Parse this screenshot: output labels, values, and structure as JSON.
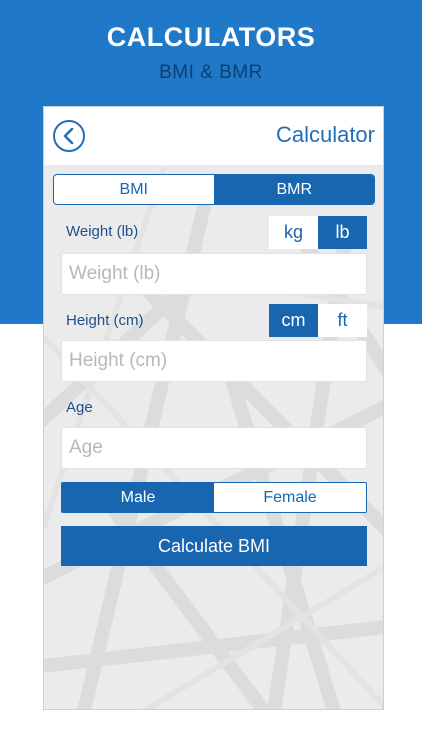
{
  "hero": {
    "title": "CALCULATORS",
    "subtitle": "BMI & BMR"
  },
  "appbar": {
    "title": "Calculator",
    "back_icon": "chevron-left-circle-icon"
  },
  "mode_tabs": [
    {
      "label": "BMI",
      "active": false
    },
    {
      "label": "BMR",
      "active": true
    }
  ],
  "weight": {
    "label": "Weight (lb)",
    "placeholder": "Weight (lb)",
    "units": [
      {
        "label": "kg",
        "active": false
      },
      {
        "label": "lb",
        "active": true
      }
    ]
  },
  "height": {
    "label": "Height (cm)",
    "placeholder": "Height (cm)",
    "units": [
      {
        "label": "cm",
        "active": true
      },
      {
        "label": "ft",
        "active": false
      }
    ]
  },
  "age": {
    "label": "Age",
    "placeholder": "Age"
  },
  "gender": [
    {
      "label": "Male",
      "active": true
    },
    {
      "label": "Female",
      "active": false
    }
  ],
  "calculate_label": "Calculate BMI",
  "colors": {
    "primary": "#1866b0",
    "band": "#1f78c8",
    "hero_subtitle": "#0f3f6e",
    "panel": "#ebebeb"
  }
}
